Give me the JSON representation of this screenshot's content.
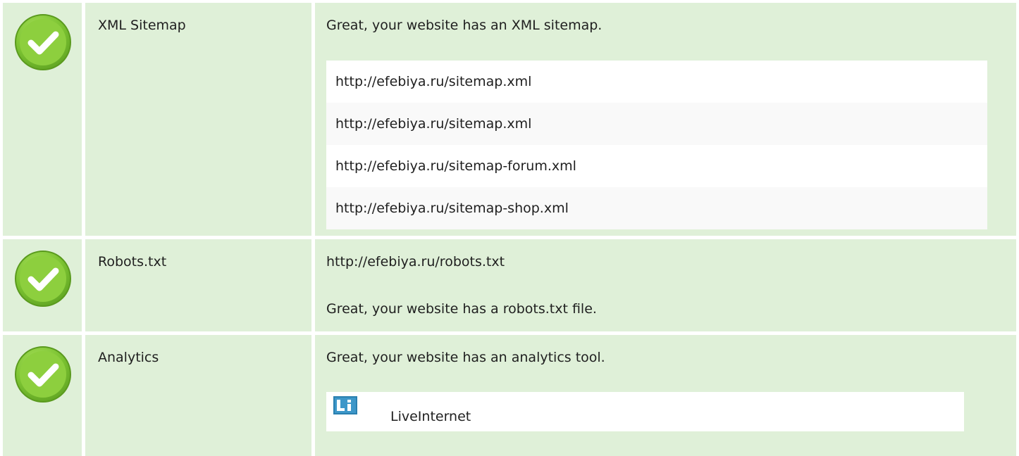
{
  "colors": {
    "row_background": "#dff0d8",
    "check_green": "#7cc332",
    "check_border": "#5a9a1e",
    "logo_blue": "#2a80b0"
  },
  "rows": [
    {
      "status_icon": "checkmark-circle-icon",
      "label": "XML Sitemap",
      "message": "Great, your website has an XML sitemap.",
      "urls": [
        "http://efebiya.ru/sitemap.xml",
        "http://efebiya.ru/sitemap.xml",
        "http://efebiya.ru/sitemap-forum.xml",
        "http://efebiya.ru/sitemap-shop.xml"
      ]
    },
    {
      "status_icon": "checkmark-circle-icon",
      "label": "Robots.txt",
      "url": "http://efebiya.ru/robots.txt",
      "message": "Great, your website has a robots.txt file."
    },
    {
      "status_icon": "checkmark-circle-icon",
      "label": "Analytics",
      "message": "Great, your website has an analytics tool.",
      "tool": {
        "icon": "liveinternet-logo-icon",
        "name": "LiveInternet"
      }
    }
  ]
}
